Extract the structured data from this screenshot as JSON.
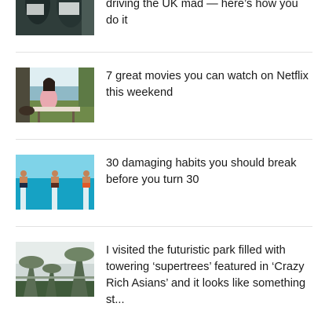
{
  "feed": {
    "articles": [
      {
        "headline": "driving the UK mad — here’s how you do it",
        "image": "football-players-celebrating-image"
      },
      {
        "headline": "7 great movies you can watch on Netflix this weekend",
        "image": "woman-at-lakeside-table-image"
      },
      {
        "headline": "30 damaging habits you should break before you turn 30",
        "image": "three-people-on-posts-at-sea-image"
      },
      {
        "headline": "I visited the futuristic park filled with towering ‘supertrees’ featured in ‘Crazy Rich Asians’ and it looks like something st...",
        "image": "supertrees-park-image"
      }
    ]
  }
}
